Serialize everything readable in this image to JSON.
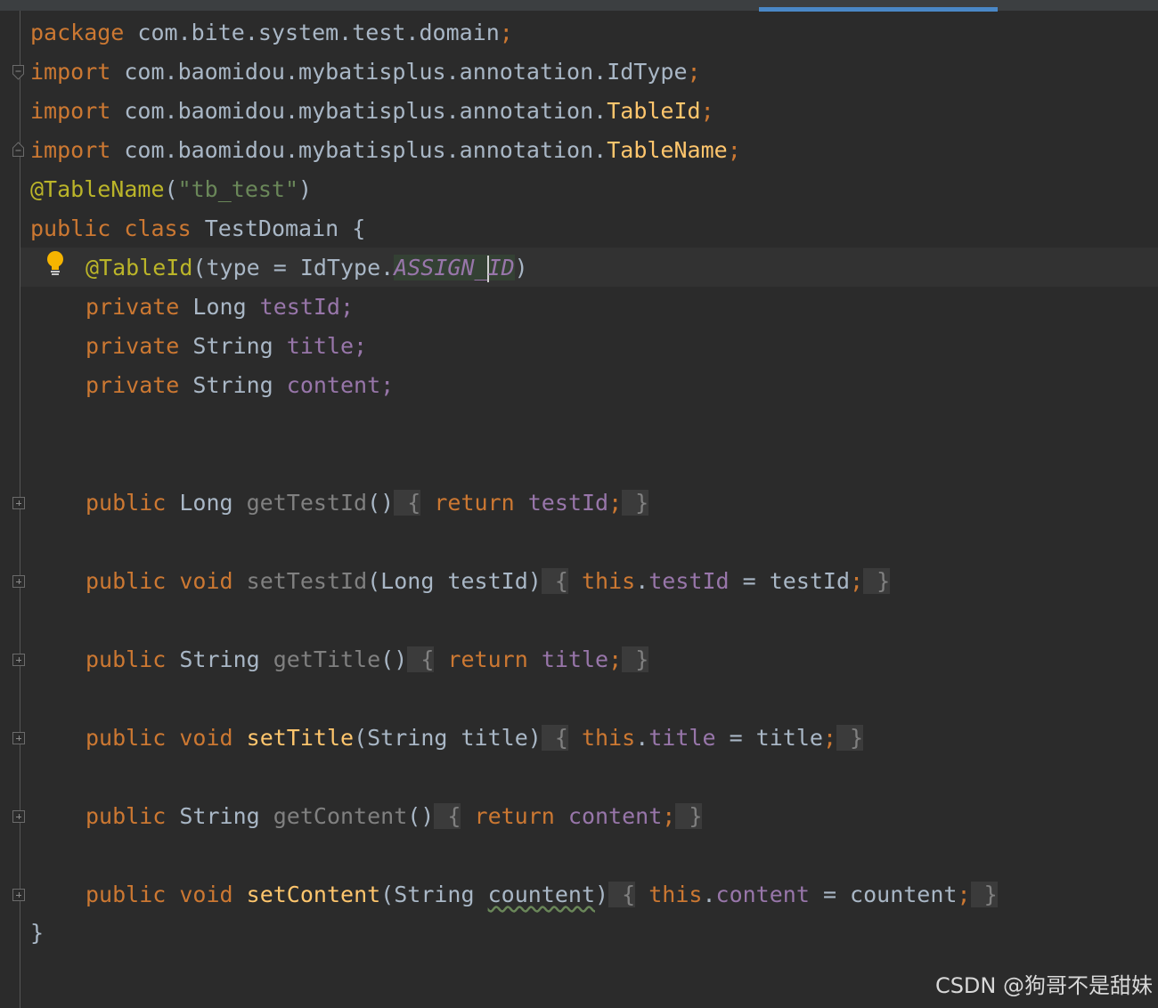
{
  "code": {
    "package_kw": "package",
    "package_name": " com.bite.system.test.domain",
    "semi": ";",
    "import_kw": "import",
    "import1_path": " com.baomidou.mybatisplus.annotation.IdType",
    "import2_path": " com.baomidou.mybatisplus.annotation.",
    "import2_class": "TableId",
    "import3_path": " com.baomidou.mybatisplus.annotation.",
    "import3_class": "TableName",
    "ann_tablename": "@TableName",
    "paren_open": "(",
    "paren_close": ")",
    "table_string": "\"tb_test\"",
    "public_kw": "public",
    "class_kw": "class",
    "class_name": " TestDomain {",
    "ann_tableid": "@TableId",
    "tableid_args": "(type = IdType.",
    "assign_id_a": "ASSIGN_",
    "assign_id_b": "ID",
    "private_kw": "private",
    "type_long": " Long ",
    "type_string": " String ",
    "field_testid": "testId;",
    "field_title": "title;",
    "field_content": "content;",
    "void_kw": "void",
    "return_kw": "return",
    "this_kw": "this",
    "m_get_testid": "getTestId",
    "m_set_testid": "setTestId",
    "m_get_title": "getTitle",
    "m_set_title": "setTitle",
    "m_get_content": "getContent",
    "m_set_content": "setContent",
    "param_long_testid": "(Long testId)",
    "param_string_title": "(String title)",
    "param_string_open": "(String ",
    "param_countent": "countent",
    "empty_parens": "()",
    "brace_open": " {",
    "brace_close": " }",
    "body_testid": "testId",
    "body_title": "title",
    "body_content": "content",
    "assign_testid": " = testId",
    "assign_title": " = title",
    "assign_countent": " = countent",
    "dot": ".",
    "close_class": "}"
  },
  "watermark": "CSDN @狗哥不是甜妹",
  "icons": {
    "bulb": "lightbulb-icon",
    "fold": "fold-icon"
  }
}
